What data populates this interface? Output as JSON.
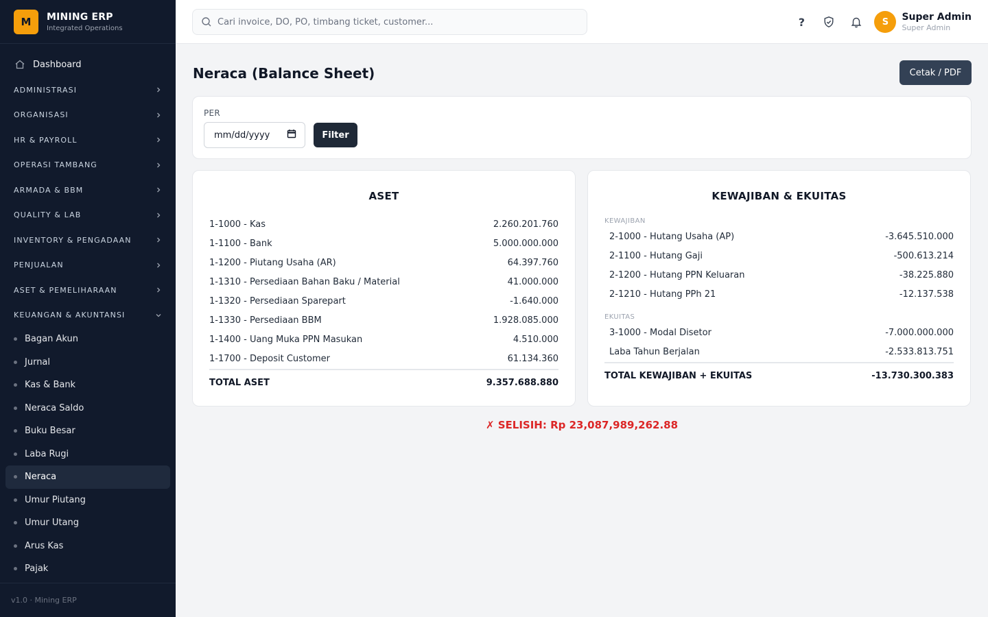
{
  "brand": {
    "logo_letter": "M",
    "title": "MINING ERP",
    "subtitle": "Integrated Operations"
  },
  "nav": {
    "dashboard": "Dashboard",
    "groups": [
      "ADMINISTRASI",
      "ORGANISASI",
      "HR & PAYROLL",
      "OPERASI TAMBANG",
      "ARMADA & BBM",
      "QUALITY & LAB",
      "INVENTORY & PENGADAAN",
      "PENJUALAN",
      "ASET & PEMELIHARAAN"
    ],
    "open_group": "KEUANGAN & AKUNTANSI",
    "sub_items": [
      "Bagan Akun",
      "Jurnal",
      "Kas & Bank",
      "Neraca Saldo",
      "Buku Besar",
      "Laba Rugi",
      "Neraca",
      "Umur Piutang",
      "Umur Utang",
      "Arus Kas",
      "Pajak"
    ],
    "active_item": "Neraca"
  },
  "footer": "v1.0 · Mining ERP",
  "search": {
    "placeholder": "Cari invoice, DO, PO, timbang ticket, customer..."
  },
  "user": {
    "initial": "S",
    "name": "Super Admin",
    "role": "Super Admin"
  },
  "page": {
    "title": "Neraca (Balance Sheet)",
    "print_label": "Cetak / PDF"
  },
  "filter": {
    "label": "PER",
    "date_placeholder": "mm/dd/yyyy",
    "button": "Filter"
  },
  "assets": {
    "title": "ASET",
    "rows": [
      {
        "account": "1-1000 - Kas",
        "amount": "2.260.201.760"
      },
      {
        "account": "1-1100 - Bank",
        "amount": "5.000.000.000"
      },
      {
        "account": "1-1200 - Piutang Usaha (AR)",
        "amount": "64.397.760"
      },
      {
        "account": "1-1310 - Persediaan Bahan Baku / Material",
        "amount": "41.000.000"
      },
      {
        "account": "1-1320 - Persediaan Sparepart",
        "amount": "-1.640.000"
      },
      {
        "account": "1-1330 - Persediaan BBM",
        "amount": "1.928.085.000"
      },
      {
        "account": "1-1400 - Uang Muka PPN Masukan",
        "amount": "4.510.000"
      },
      {
        "account": "1-1700 - Deposit Customer",
        "amount": "61.134.360"
      }
    ],
    "total_label": "TOTAL ASET",
    "total": "9.357.688.880"
  },
  "liabilities_equity": {
    "title": "KEWAJIBAN & EKUITAS",
    "liabilities_label": "KEWAJIBAN",
    "liabilities": [
      {
        "account": "2-1000 - Hutang Usaha (AP)",
        "amount": "-3.645.510.000"
      },
      {
        "account": "2-1100 - Hutang Gaji",
        "amount": "-500.613.214"
      },
      {
        "account": "2-1200 - Hutang PPN Keluaran",
        "amount": "-38.225.880"
      },
      {
        "account": "2-1210 - Hutang PPh 21",
        "amount": "-12.137.538"
      }
    ],
    "equity_label": "EKUITAS",
    "equity": [
      {
        "account": "3-1000 - Modal Disetor",
        "amount": "-7.000.000.000"
      },
      {
        "account": "Laba Tahun Berjalan",
        "amount": "-2.533.813.751"
      }
    ],
    "total_label": "TOTAL KEWAJIBAN + EKUITAS",
    "total": "-13.730.300.383"
  },
  "difference": "✗ SELISIH: Rp 23,087,989,262.88",
  "colors": {
    "sidebar_bg": "#111a2c",
    "brand_accent": "#f59e0b",
    "error": "#dc2626",
    "button_dark": "#1f2937"
  }
}
